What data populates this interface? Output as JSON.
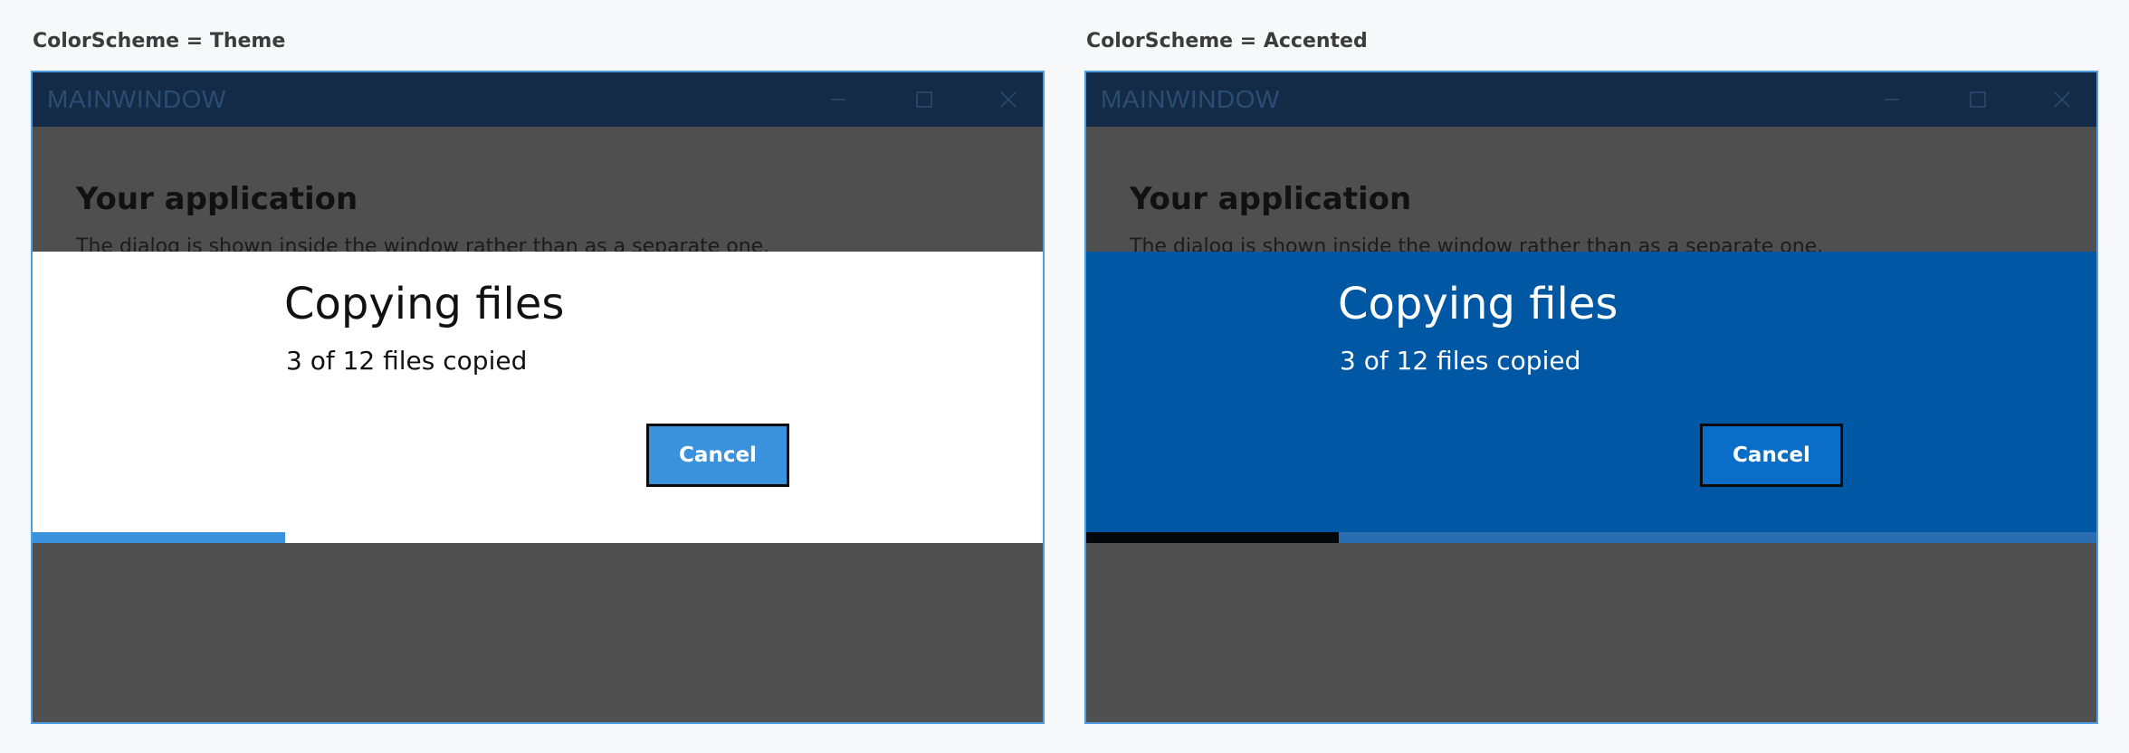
{
  "panels": [
    {
      "caption": "ColorScheme = Theme",
      "window_title": "MAINWINDOW",
      "app_title": "Your application",
      "app_description": "The dialog is shown inside the window rather than as a separate one.",
      "dialog": {
        "title": "Copying files",
        "message": "3 of 12 files copied",
        "cancel_label": "Cancel",
        "progress_fraction": 0.25,
        "background": "#ffffff",
        "button_color": "#3a92dc",
        "progress_color": "#3a92dc"
      }
    },
    {
      "caption": "ColorScheme = Accented",
      "window_title": "MAINWINDOW",
      "app_title": "Your application",
      "app_description": "The dialog is shown inside the window rather than as a separate one.",
      "dialog": {
        "title": "Copying files",
        "message": "3 of 12 files copied",
        "cancel_label": "Cancel",
        "progress_fraction": 0.25,
        "background": "#0057a3",
        "button_color": "#0a6ec9",
        "progress_color": "#05070b"
      }
    }
  ],
  "icons": {
    "minimize": "minimize-icon",
    "maximize": "maximize-icon",
    "close": "close-icon"
  },
  "colors": {
    "titlebar": "#132b47",
    "window_border": "#4f9ee5",
    "window_background": "#4f4f4f"
  }
}
